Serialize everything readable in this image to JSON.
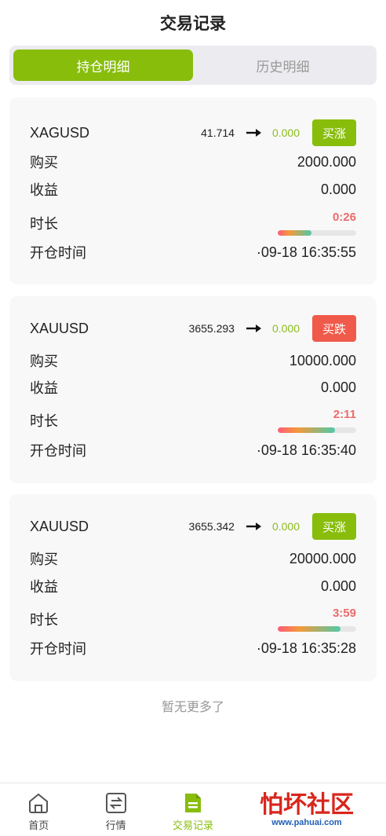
{
  "header": {
    "title": "交易记录"
  },
  "tabs": [
    {
      "label": "持仓明细",
      "active": true
    },
    {
      "label": "历史明细",
      "active": false
    }
  ],
  "row_labels": {
    "buy": "购买",
    "profit": "收益",
    "duration": "时长",
    "open_time": "开仓时间"
  },
  "positions": [
    {
      "symbol": "XAGUSD",
      "price": "41.714",
      "pnl": "0.000",
      "direction": "买涨",
      "buy": "2000.000",
      "profit": "0.000",
      "duration": "0:26",
      "progress": 0.43,
      "open_time": "·09-18 16:35:55"
    },
    {
      "symbol": "XAUUSD",
      "price": "3655.293",
      "pnl": "0.000",
      "direction": "买跌",
      "buy": "10000.000",
      "profit": "0.000",
      "duration": "2:11",
      "progress": 0.73,
      "open_time": "·09-18 16:35:40"
    },
    {
      "symbol": "XAUUSD",
      "price": "3655.342",
      "pnl": "0.000",
      "direction": "买涨",
      "buy": "20000.000",
      "profit": "0.000",
      "duration": "3:59",
      "progress": 0.8,
      "open_time": "·09-18 16:35:28"
    }
  ],
  "footer_note": "暂无更多了",
  "nav": [
    {
      "label": "首页",
      "icon": "home-icon",
      "active": false
    },
    {
      "label": "行情",
      "icon": "exchange-icon",
      "active": false
    },
    {
      "label": "交易记录",
      "icon": "document-icon",
      "active": true
    }
  ],
  "watermark": {
    "text": "怕坏社区",
    "url": "www.pahuai.com"
  },
  "colors": {
    "accent": "#88bd0c",
    "down": "#f05a4a",
    "duration": "#ec6b6b"
  }
}
